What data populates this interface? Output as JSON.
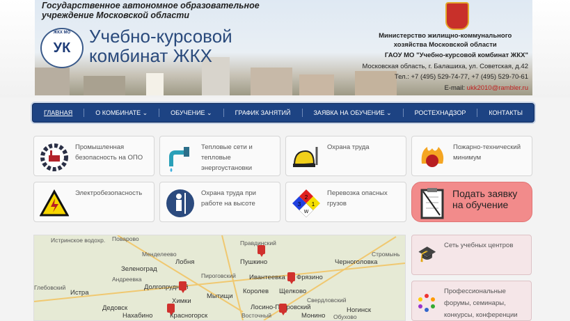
{
  "header": {
    "org_line1": "Государственное автономное образовательное",
    "org_line2": "учреждение Московской области",
    "logo_text": "УК",
    "logo_caption": "ЖКХ МО",
    "brand_line1": "Учебно-курсовой",
    "brand_line2": "комбинат ЖКХ",
    "ministry_line1": "Министерство жилищно-коммунального",
    "ministry_line2": "хозяйства Московской области",
    "org_short": "ГАОУ МО \"Учебно-курсовой комбинат ЖКХ\"",
    "address": "Московская область, г. Балашиха, ул. Советская, д.42",
    "phone": "Тел.: +7 (495) 529-74-77, +7 (495) 529-70-61",
    "email_label": "E-mail:",
    "email": "ukk2010@rambler.ru"
  },
  "nav": [
    {
      "label": "ГЛАВНАЯ"
    },
    {
      "label": "О КОМБИНАТЕ ⌄"
    },
    {
      "label": "ОБУЧЕНИЕ ⌄"
    },
    {
      "label": "ГРАФИК ЗАНЯТИЙ"
    },
    {
      "label": "ЗАЯВКА НА ОБУЧЕНИЕ ⌄"
    },
    {
      "label": "РОСТЕХНАДЗОР"
    },
    {
      "label": "КОНТАКТЫ"
    }
  ],
  "cards": [
    {
      "label": "Промышленная безопасность на ОПО",
      "icon": "industry-gear-icon"
    },
    {
      "label": "Тепловые сети и тепловые энергоустановки",
      "icon": "faucet-icon"
    },
    {
      "label": "Охрана труда",
      "icon": "hard-hat-icon"
    },
    {
      "label": "Пожарно-технический минимум",
      "icon": "fire-icon"
    },
    {
      "label": "Электробезопасность",
      "icon": "high-voltage-icon"
    },
    {
      "label": "Охрана труда при работе на высоте",
      "icon": "safety-harness-icon"
    },
    {
      "label": "Перевозка опасных грузов",
      "icon": "hazard-diamond-icon"
    },
    {
      "label": "Подать заявку на обучение",
      "icon": "clipboard-icon"
    }
  ],
  "hazard": {
    "top": "2",
    "left": "3",
    "right": "1",
    "bottom": "W"
  },
  "map": {
    "cities": [
      "Истринское водохр.",
      "Поварово",
      "Менделеево",
      "Лобня",
      "Зеленоград",
      "Андреевка",
      "Пироговский",
      "Правдинский",
      "Пушкино",
      "Стромынь",
      "Черноголовка",
      "Ивантеевка",
      "Фрязино",
      "Глебовский",
      "Долгопрудный",
      "Королев",
      "Щелково",
      "Истра",
      "Химки",
      "Мытищи",
      "Свердловский",
      "Дедовск",
      "Лосино-Петровский",
      "Ногинск",
      "Нахабино",
      "Красногорск",
      "Восточный",
      "Монино",
      "Обухово"
    ]
  },
  "side": [
    {
      "label": "Сеть учебных центров",
      "icon": "graduation-cap-icon"
    },
    {
      "label": "Профессиональные форумы, семинары, конкурсы, конференции",
      "icon": "people-circle-icon"
    }
  ]
}
